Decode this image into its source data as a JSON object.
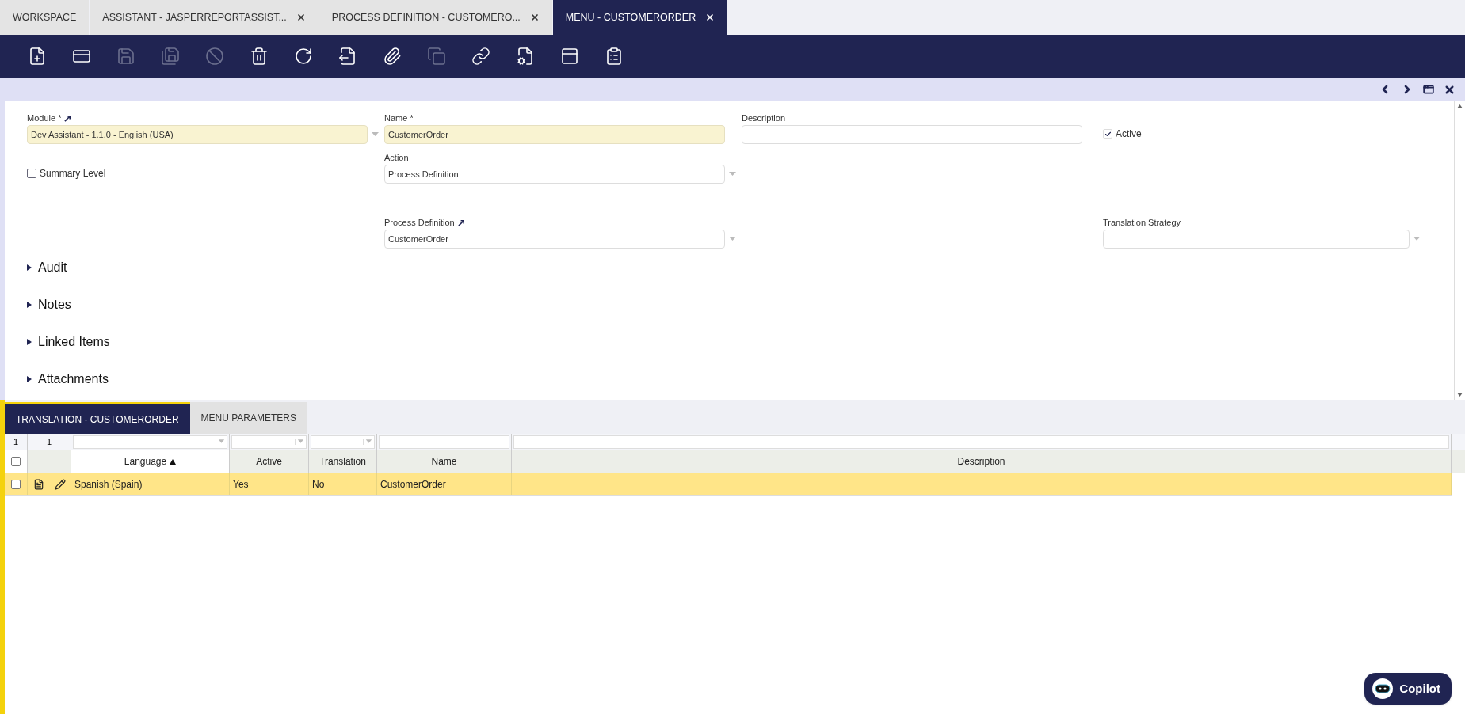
{
  "tabs": [
    {
      "label": "WORKSPACE",
      "closable": false,
      "selected": false
    },
    {
      "label": "ASSISTANT - JASPERREPORTASSIST...",
      "closable": true,
      "selected": false
    },
    {
      "label": "PROCESS DEFINITION - CUSTOMERO...",
      "closable": true,
      "selected": false
    },
    {
      "label": "MENU - CUSTOMERORDER",
      "closable": true,
      "selected": true
    }
  ],
  "toolbar": [
    {
      "disabled": false
    },
    {
      "disabled": false
    },
    {
      "disabled": true
    },
    {
      "disabled": true
    },
    {
      "disabled": true
    },
    {
      "disabled": false
    },
    {
      "disabled": false
    },
    {
      "disabled": false
    },
    {
      "disabled": false
    },
    {
      "disabled": true
    },
    {
      "disabled": false
    },
    {
      "disabled": false
    },
    {
      "disabled": false
    },
    {
      "disabled": false
    }
  ],
  "fields": [
    {
      "kind": "select",
      "label": "Module *",
      "value": "Dev Assistant - 1.1.0 - English (USA)",
      "required": true,
      "linked": true
    },
    {
      "kind": "text",
      "label": "Name *",
      "value": "CustomerOrder",
      "required": true,
      "linked": false
    },
    {
      "kind": "text",
      "label": "Description",
      "required": false,
      "linked": false
    },
    {
      "kind": "checkbox",
      "label": "Active",
      "checked": true
    },
    {
      "kind": "checkbox",
      "label": "Summary Level",
      "checked": false
    },
    {
      "kind": "select",
      "label": "Action",
      "value": "Process Definition",
      "required": false,
      "linked": false
    },
    {
      "kind": "select",
      "label": "Process Definition",
      "value": "CustomerOrder",
      "required": false,
      "linked": true
    },
    {
      "kind": "select",
      "label": "Translation Strategy",
      "required": false,
      "linked": false
    }
  ],
  "sections": [
    {
      "label": "Audit",
      "expanded": false
    },
    {
      "label": "Notes",
      "expanded": false
    },
    {
      "label": "Linked Items",
      "expanded": false
    },
    {
      "label": "Attachments",
      "expanded": false
    }
  ],
  "subtabs": [
    {
      "label": "TRANSLATION - CUSTOMERORDER",
      "selected": true
    },
    {
      "label": "MENU PARAMETERS",
      "selected": false
    }
  ],
  "grid": {
    "counts": [
      "1",
      "1"
    ],
    "all_checked": false,
    "columns": [
      {
        "label": "Language",
        "sorted": true,
        "filter_dropdown": true
      },
      {
        "label": "Active",
        "sorted": false,
        "filter_dropdown": true
      },
      {
        "label": "Translation",
        "sorted": false,
        "filter_dropdown": true
      },
      {
        "label": "Name",
        "sorted": false,
        "filter_dropdown": false
      },
      {
        "label": "Description",
        "sorted": false,
        "filter_dropdown": false
      }
    ],
    "rows": [
      {
        "selected": true,
        "checked": false,
        "cells": [
          "Spanish (Spain)",
          "Yes",
          "No",
          "CustomerOrder",
          ""
        ]
      }
    ]
  },
  "copilot": {
    "label": "Copilot"
  }
}
